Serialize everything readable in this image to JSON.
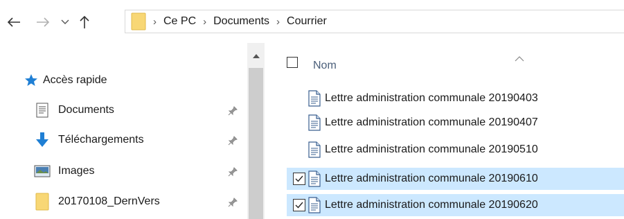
{
  "toolbar": {
    "back_icon": "arrow-left-icon",
    "forward_icon": "arrow-right-icon",
    "recent_icon": "chevron-down-icon",
    "up_icon": "arrow-up-icon"
  },
  "address": {
    "crumbs": [
      "Ce PC",
      "Documents",
      "Courrier"
    ]
  },
  "sidebar": {
    "quick_access": "Accès rapide",
    "items": [
      {
        "label": "Documents",
        "icon": "documents-icon",
        "pinned": true
      },
      {
        "label": "Téléchargements",
        "icon": "download-arrow-icon",
        "pinned": true
      },
      {
        "label": "Images",
        "icon": "images-icon",
        "pinned": true
      },
      {
        "label": "20170108_DernVers",
        "icon": "folder-icon",
        "pinned": true
      }
    ]
  },
  "file_list": {
    "header": {
      "name": "Nom"
    },
    "rows": [
      {
        "name": "Lettre administration communale 20190403",
        "selected": false
      },
      {
        "name": "Lettre administration communale 20190407",
        "selected": false
      },
      {
        "name": "Lettre administration communale 20190510",
        "selected": false
      },
      {
        "name": "Lettre administration communale 20190610",
        "selected": true
      },
      {
        "name": "Lettre administration communale 20190620",
        "selected": true
      }
    ]
  },
  "colors": {
    "selection": "#cce8ff",
    "folder": "#f8d775",
    "quick_access_star": "#1f7fd4",
    "header_text": "#4b5f7a"
  }
}
